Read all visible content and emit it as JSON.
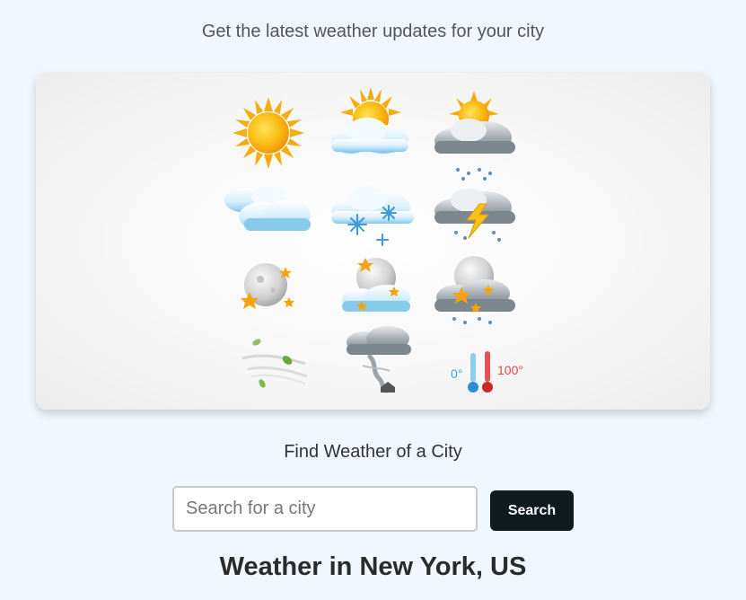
{
  "header": {
    "subtitle": "Get the latest weather updates for your city"
  },
  "hero": {
    "icons": [
      "sun-icon",
      "partly-cloudy-icon",
      "sun-cloud-rain-icon",
      "clouds-icon",
      "snow-cloud-icon",
      "thunderstorm-icon",
      "moon-stars-icon",
      "moon-cloud-stars-icon",
      "moon-dark-cloud-icon",
      "wind-leaves-icon",
      "tornado-icon",
      "thermometer-icon"
    ],
    "thermo_low": "0°",
    "thermo_high": "100°"
  },
  "search": {
    "title": "Find Weather of a City",
    "placeholder": "Search for a city",
    "button_label": "Search"
  },
  "result": {
    "heading": "Weather in New York, US"
  },
  "colors": {
    "background": "#f0f7fe",
    "button": "#0f1a1f",
    "sun": "#f6b613",
    "cloud": "#8fd0f0",
    "storm_cloud": "#7f8b93"
  }
}
